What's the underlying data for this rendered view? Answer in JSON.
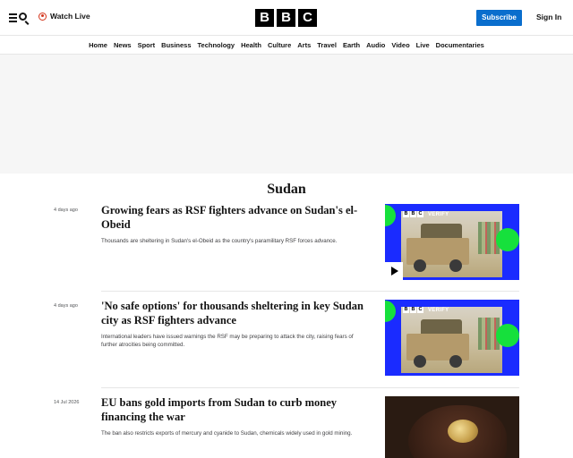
{
  "header": {
    "watch_live_label": "Watch Live",
    "logo_letters": [
      "B",
      "B",
      "C"
    ],
    "subscribe_label": "Subscribe",
    "signin_label": "Sign In"
  },
  "nav": {
    "items": [
      "Home",
      "News",
      "Sport",
      "Business",
      "Technology",
      "Health",
      "Culture",
      "Arts",
      "Travel",
      "Earth",
      "Audio",
      "Video",
      "Live",
      "Documentaries"
    ]
  },
  "section": {
    "title": "Sudan"
  },
  "articles": [
    {
      "date": "4 days ago",
      "headline": "Growing fears as RSF fighters advance on Sudan's el-Obeid",
      "summary": "Thousands are sheltering in Sudan's el-Obeid as the country's paramilitary RSF forces advance.",
      "thumb_label": "VERIFY",
      "has_video": true
    },
    {
      "date": "4 days ago",
      "headline": "'No safe options' for thousands sheltering in key Sudan city as RSF fighters advance",
      "summary": "International leaders have issued warnings the RSF may be preparing to attack the city, raising fears of further atrocities being committed.",
      "thumb_label": "VERIFY",
      "has_video": false
    },
    {
      "date": "14 Jul 2026",
      "headline": "EU bans gold imports from Sudan to curb money financing the war",
      "summary": "The ban also restricts exports of mercury and cyanide to Sudan, chemicals widely used in gold mining.",
      "has_video": false
    }
  ],
  "colors": {
    "subscribe_bg": "#0a6ecd",
    "live_red": "#d4351c",
    "verify_blue": "#1a2bff",
    "verify_green": "#16e03c"
  }
}
